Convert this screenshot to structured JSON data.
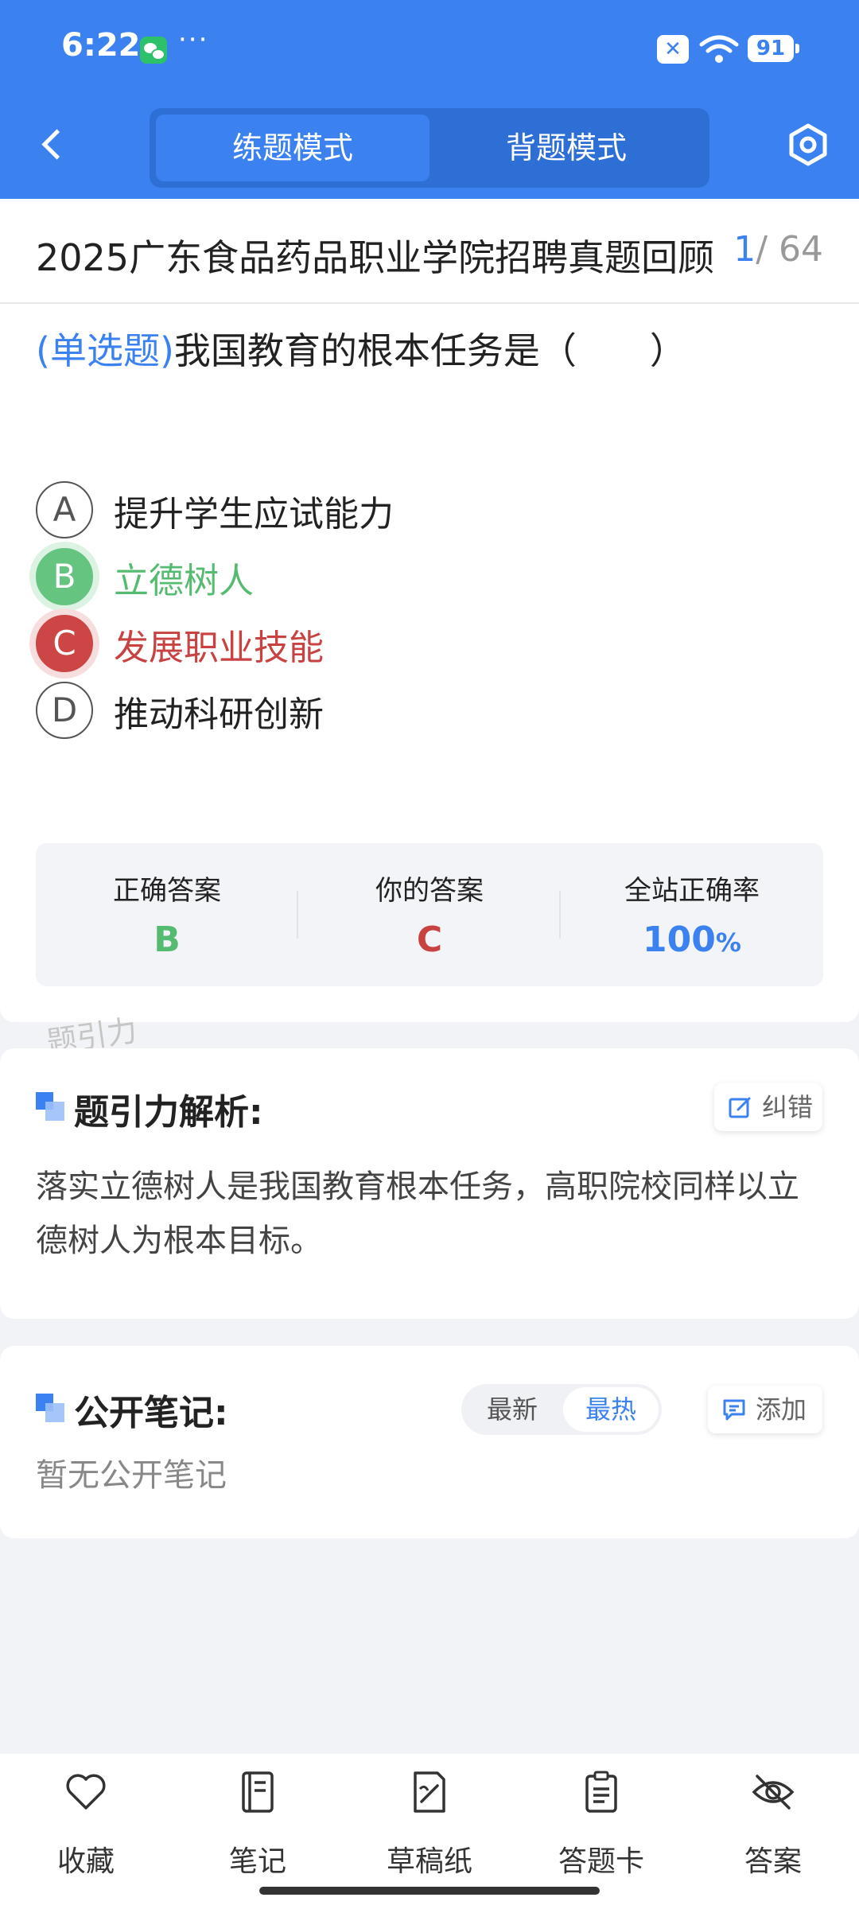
{
  "status_bar": {
    "time": "6:22",
    "dots": "···",
    "battery": "91"
  },
  "header": {
    "modes": [
      "练题模式",
      "背题模式"
    ],
    "active_mode": "练题模式"
  },
  "paper": {
    "title": "2025广东食品药品职业学院招聘真题回顾",
    "current": "1",
    "total": "/ 64"
  },
  "question": {
    "type": "(单选题)",
    "text": "我国教育的根本任务是（　　）",
    "options": [
      {
        "letter": "A",
        "text": "提升学生应试能力",
        "state": "normal"
      },
      {
        "letter": "B",
        "text": "立德树人",
        "state": "correct"
      },
      {
        "letter": "C",
        "text": "发展职业技能",
        "state": "wrong"
      },
      {
        "letter": "D",
        "text": "推动科研创新",
        "state": "normal"
      }
    ]
  },
  "result": {
    "correct_label": "正确答案",
    "correct_value": "B",
    "yours_label": "你的答案",
    "yours_value": "C",
    "rate_label": "全站正确率",
    "rate_value": "100",
    "rate_unit": "%"
  },
  "watermark": "题引力",
  "analysis": {
    "title": "题引力解析:",
    "report_label": "纠错",
    "text": "落实立德树人是我国教育根本任务，高职院校同样以立德树人为根本目标。"
  },
  "notes": {
    "title": "公开笔记:",
    "sort_newest": "最新",
    "sort_hottest": "最热",
    "add_label": "添加",
    "empty": "暂无公开笔记"
  },
  "bottom_nav": {
    "favorite": "收藏",
    "notes": "笔记",
    "scratch": "草稿纸",
    "answer_card": "答题卡",
    "answer": "答案"
  },
  "colors": {
    "primary": "#3b82f0",
    "correct": "#55bb70",
    "wrong": "#c84242"
  }
}
